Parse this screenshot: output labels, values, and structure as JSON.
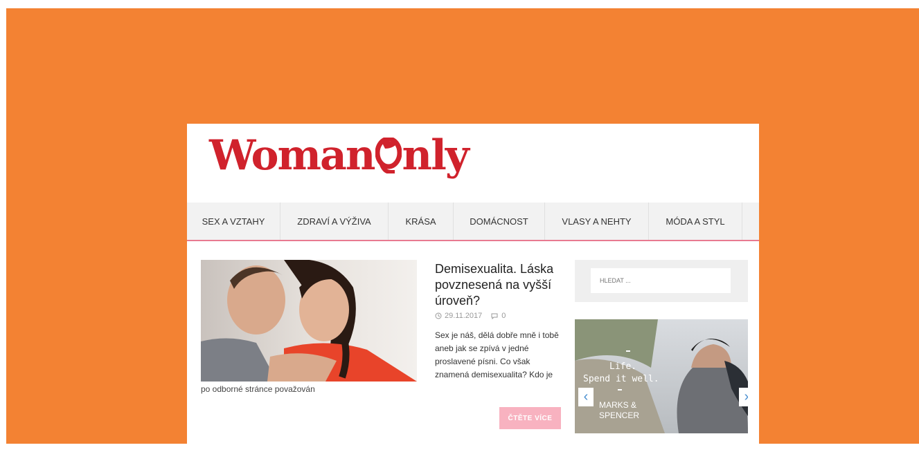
{
  "brand": {
    "logo_left": "Woman",
    "logo_right": "nly",
    "color": "#d0222c"
  },
  "colors": {
    "background": "#f38233",
    "accent_pink": "#e87a90",
    "button_pink": "#f8b2c0"
  },
  "nav": {
    "items": [
      {
        "label": "SEX A VZTAHY"
      },
      {
        "label": "ZDRAVÍ A VÝŽIVA"
      },
      {
        "label": "KRÁSA"
      },
      {
        "label": "DOMÁCNOST"
      },
      {
        "label": "VLASY A NEHTY"
      },
      {
        "label": "MÓDA A STYL"
      }
    ]
  },
  "article": {
    "title": "Demisexualita. Láska povznesená na vyšší úroveň?",
    "date": "29.11.2017",
    "comments": "0",
    "excerpt": "Sex je náš, dělá dobře mně i tobě aneb jak se zpívá v jedné proslavené písni. Co však znamená demisexualita? Kdo je",
    "caption": "po odborné stránce považován",
    "read_more": "ČTĚTE VÍCE",
    "icons": {
      "date": "clock-icon",
      "comments": "comment-icon"
    }
  },
  "sidebar": {
    "search": {
      "placeholder": "HLEDAT ..."
    },
    "banner": {
      "line1": "Life.",
      "line2": "Spend it well.",
      "brand1": "MARKS &",
      "brand2": "SPENCER",
      "prev": "‹",
      "next": "›"
    }
  }
}
